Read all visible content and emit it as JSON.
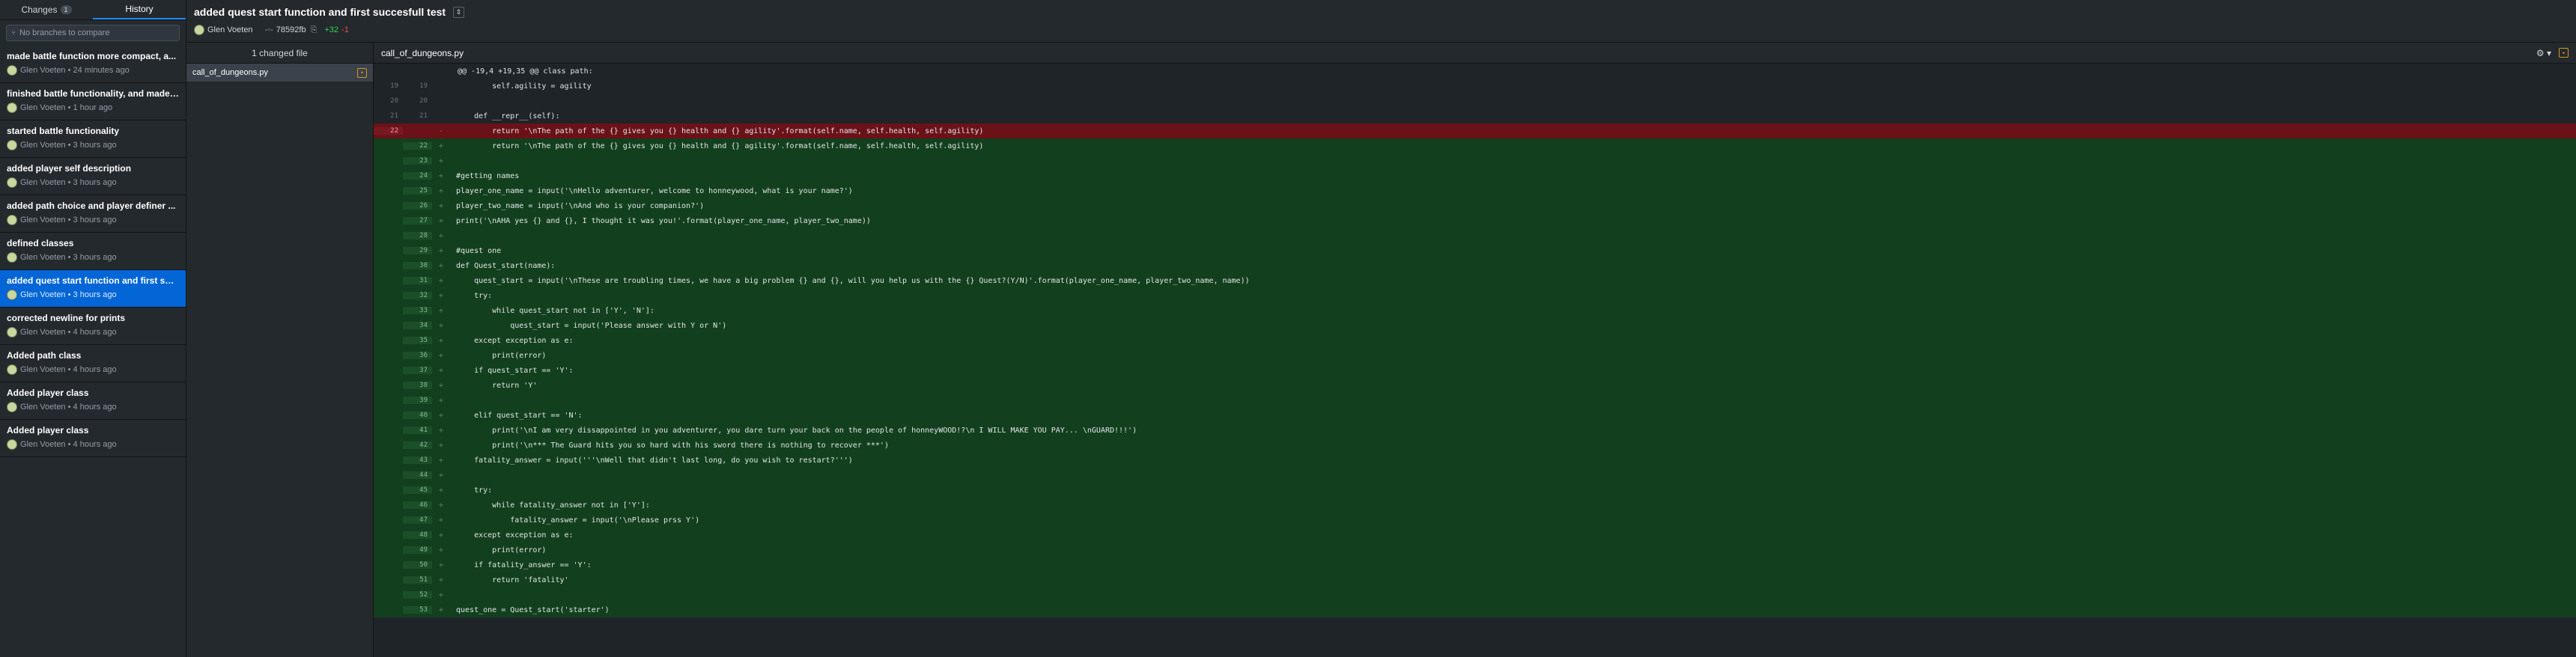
{
  "tabs": {
    "changes": "Changes",
    "changes_count": "1",
    "history": "History"
  },
  "branch_compare": {
    "placeholder": "No branches to compare"
  },
  "commits": [
    {
      "title": "made battle function more compact, a...",
      "author": "Glen Voeten",
      "time": "24 minutes ago"
    },
    {
      "title": "finished battle functionality, and made ...",
      "author": "Glen Voeten",
      "time": "1 hour ago"
    },
    {
      "title": "started battle functionality",
      "author": "Glen Voeten",
      "time": "3 hours ago"
    },
    {
      "title": "added player self description",
      "author": "Glen Voeten",
      "time": "3 hours ago"
    },
    {
      "title": "added path choice and player definer ...",
      "author": "Glen Voeten",
      "time": "3 hours ago"
    },
    {
      "title": "defined classes",
      "author": "Glen Voeten",
      "time": "3 hours ago"
    },
    {
      "title": "added quest start function and first succ...",
      "author": "Glen Voeten",
      "time": "3 hours ago"
    },
    {
      "title": "corrected newline for prints",
      "author": "Glen Voeten",
      "time": "4 hours ago"
    },
    {
      "title": "Added path class",
      "author": "Glen Voeten",
      "time": "4 hours ago"
    },
    {
      "title": "Added player class",
      "author": "Glen Voeten",
      "time": "4 hours ago"
    },
    {
      "title": "Added player class",
      "author": "Glen Voeten",
      "time": "4 hours ago"
    }
  ],
  "selected_commit": {
    "title": "added quest start function and first succesfull test",
    "author": "Glen Voeten",
    "sha": "78592fb",
    "additions": "+32",
    "deletions": "-1"
  },
  "files": {
    "header": "1 changed file",
    "items": [
      {
        "name": "call_of_dungeons.py"
      }
    ]
  },
  "diff": {
    "filename": "call_of_dungeons.py",
    "settings_label": "⚙ ▾"
  },
  "diff_lines": [
    {
      "type": "hunk",
      "old": "",
      "new": "",
      "mark": "",
      "code": "@@ -19,4 +19,35 @@ class path:"
    },
    {
      "type": "ctx",
      "old": "19",
      "new": "19",
      "mark": "",
      "code": "        self.agility = agility"
    },
    {
      "type": "ctx",
      "old": "20",
      "new": "20",
      "mark": "",
      "code": ""
    },
    {
      "type": "ctx",
      "old": "21",
      "new": "21",
      "mark": "",
      "code": "    def __repr__(self):"
    },
    {
      "type": "removed",
      "old": "22",
      "new": "",
      "mark": "-",
      "code": "        return '\\nThe path of the {} gives you {} health and {} agility'.format(self.name, self.health, self.agility)"
    },
    {
      "type": "added",
      "old": "",
      "new": "22",
      "mark": "+",
      "code": "        return '\\nThe path of the {} gives you {} health and {} agility'.format(self.name, self.health, self.agility)"
    },
    {
      "type": "added",
      "old": "",
      "new": "23",
      "mark": "+",
      "code": ""
    },
    {
      "type": "added",
      "old": "",
      "new": "24",
      "mark": "+",
      "code": "#getting names"
    },
    {
      "type": "added",
      "old": "",
      "new": "25",
      "mark": "+",
      "code": "player_one_name = input('\\nHello adventurer, welcome to honneywood, what is your name?')"
    },
    {
      "type": "added",
      "old": "",
      "new": "26",
      "mark": "+",
      "code": "player_two_name = input('\\nAnd who is your companion?')"
    },
    {
      "type": "added",
      "old": "",
      "new": "27",
      "mark": "+",
      "code": "print('\\nAHA yes {} and {}, I thought it was you!'.format(player_one_name, player_two_name))"
    },
    {
      "type": "added",
      "old": "",
      "new": "28",
      "mark": "+",
      "code": ""
    },
    {
      "type": "added",
      "old": "",
      "new": "29",
      "mark": "+",
      "code": "#quest one"
    },
    {
      "type": "added",
      "old": "",
      "new": "30",
      "mark": "+",
      "code": "def Quest_start(name):"
    },
    {
      "type": "added",
      "old": "",
      "new": "31",
      "mark": "+",
      "code": "    quest_start = input('\\nThese are troubling times, we have a big problem {} and {}, will you help us with the {} Quest?(Y/N)'.format(player_one_name, player_two_name, name))"
    },
    {
      "type": "added",
      "old": "",
      "new": "32",
      "mark": "+",
      "code": "    try:"
    },
    {
      "type": "added",
      "old": "",
      "new": "33",
      "mark": "+",
      "code": "        while quest_start not in ['Y', 'N']:"
    },
    {
      "type": "added",
      "old": "",
      "new": "34",
      "mark": "+",
      "code": "            quest_start = input('Please answer with Y or N')"
    },
    {
      "type": "added",
      "old": "",
      "new": "35",
      "mark": "+",
      "code": "    except exception as e:"
    },
    {
      "type": "added",
      "old": "",
      "new": "36",
      "mark": "+",
      "code": "        print(error)"
    },
    {
      "type": "added",
      "old": "",
      "new": "37",
      "mark": "+",
      "code": "    if quest_start == 'Y':"
    },
    {
      "type": "added",
      "old": "",
      "new": "38",
      "mark": "+",
      "code": "        return 'Y'"
    },
    {
      "type": "added",
      "old": "",
      "new": "39",
      "mark": "+",
      "code": ""
    },
    {
      "type": "added",
      "old": "",
      "new": "40",
      "mark": "+",
      "code": "    elif quest_start == 'N':"
    },
    {
      "type": "added",
      "old": "",
      "new": "41",
      "mark": "+",
      "code": "        print('\\nI am very dissappointed in you adventurer, you dare turn your back on the people of honneyWOOD!?\\n I WILL MAKE YOU PAY... \\nGUARD!!!')"
    },
    {
      "type": "added",
      "old": "",
      "new": "42",
      "mark": "+",
      "code": "        print('\\n*** The Guard hits you so hard with his sword there is nothing to recover ***')"
    },
    {
      "type": "added",
      "old": "",
      "new": "43",
      "mark": "+",
      "code": "    fatality_answer = input('''\\nWell that didn't last long, do you wish to restart?''')"
    },
    {
      "type": "added",
      "old": "",
      "new": "44",
      "mark": "+",
      "code": ""
    },
    {
      "type": "added",
      "old": "",
      "new": "45",
      "mark": "+",
      "code": "    try:"
    },
    {
      "type": "added",
      "old": "",
      "new": "46",
      "mark": "+",
      "code": "        while fatality_answer not in ['Y']:"
    },
    {
      "type": "added",
      "old": "",
      "new": "47",
      "mark": "+",
      "code": "            fatality_answer = input('\\nPlease prss Y')"
    },
    {
      "type": "added",
      "old": "",
      "new": "48",
      "mark": "+",
      "code": "    except exception as e:"
    },
    {
      "type": "added",
      "old": "",
      "new": "49",
      "mark": "+",
      "code": "        print(error)"
    },
    {
      "type": "added",
      "old": "",
      "new": "50",
      "mark": "+",
      "code": "    if fatality_answer == 'Y':"
    },
    {
      "type": "added",
      "old": "",
      "new": "51",
      "mark": "+",
      "code": "        return 'fatality'"
    },
    {
      "type": "added",
      "old": "",
      "new": "52",
      "mark": "+",
      "code": ""
    },
    {
      "type": "added",
      "old": "",
      "new": "53",
      "mark": "+",
      "code": "quest_one = Quest_start('starter')"
    }
  ]
}
